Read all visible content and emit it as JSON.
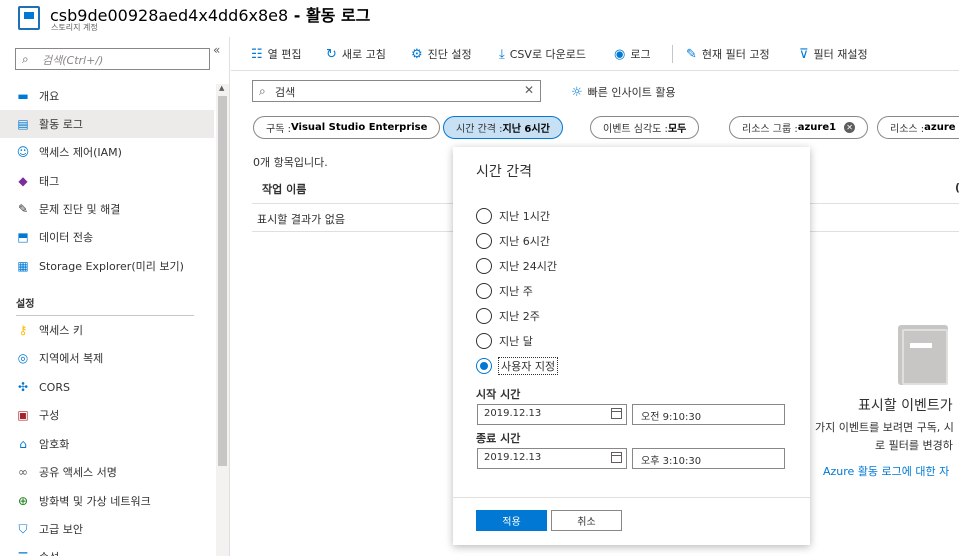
{
  "header": {
    "title": "csb9de00928aed4x4dd6x8e8",
    "separator": " - ",
    "page": "활동 로그",
    "subtitle": "스토리지 계정"
  },
  "sidebar": {
    "search_placeholder": "검색(Ctrl+/)",
    "collapse_icon": "«",
    "section_settings": "설정",
    "items": [
      {
        "label": "개요",
        "icon": "overview-icon",
        "color": "#0078d4"
      },
      {
        "label": "활동 로그",
        "icon": "activity-log-icon",
        "color": "#0078d4",
        "active": true
      },
      {
        "label": "액세스 제어(IAM)",
        "icon": "iam-icon",
        "color": "#0078d4"
      },
      {
        "label": "태그",
        "icon": "tag-icon",
        "color": "#7a2e9c"
      },
      {
        "label": "문제 진단 및 해결",
        "icon": "wrench-icon",
        "color": "#323130"
      },
      {
        "label": "데이터 전송",
        "icon": "data-transfer-icon",
        "color": "#0078d4"
      },
      {
        "label": "Storage Explorer(미리 보기)",
        "icon": "storage-explorer-icon",
        "color": "#0078d4"
      },
      {
        "label": "액세스 키",
        "icon": "key-icon",
        "color": "#ffb900"
      },
      {
        "label": "지역에서 복제",
        "icon": "geo-replication-icon",
        "color": "#0078d4"
      },
      {
        "label": "CORS",
        "icon": "cors-icon",
        "color": "#0078d4"
      },
      {
        "label": "구성",
        "icon": "configuration-icon",
        "color": "#a4262c"
      },
      {
        "label": "암호화",
        "icon": "lock-icon",
        "color": "#0078d4"
      },
      {
        "label": "공유 액세스 서명",
        "icon": "link-icon",
        "color": "#605e5c"
      },
      {
        "label": "방화벽 및 가상 네트워크",
        "icon": "network-icon",
        "color": "#107c10"
      },
      {
        "label": "고급 보안",
        "icon": "shield-icon",
        "color": "#0078d4"
      },
      {
        "label": "속성",
        "icon": "properties-icon",
        "color": "#0078d4"
      }
    ]
  },
  "toolbar": {
    "edit_columns": "열 편집",
    "refresh": "새로 고침",
    "diagnostic_settings": "진단 설정",
    "download_csv": "CSV로 다운로드",
    "logs": "로그",
    "pin_filters": "현재 필터 고정",
    "reset_filters": "필터 재설정"
  },
  "filters": {
    "search_placeholder": "검색",
    "quick_insights": "빠른 인사이트 활용",
    "pills": [
      {
        "key": "구독 : ",
        "value": "Visual Studio Enterprise"
      },
      {
        "key": "시간 간격 : ",
        "value": "지난 6시간"
      },
      {
        "key": "이벤트 심각도 : ",
        "value": "모두"
      },
      {
        "key": "리소스 그룹 : ",
        "value": "azure1"
      },
      {
        "key": "리소스 : ",
        "value": "azure"
      }
    ]
  },
  "results": {
    "count_text": "0개 항목입니다.",
    "col_operation": "작업 이름",
    "col_second": "(",
    "no_results": "표시할 결과가 없음",
    "empty_title": "표시할 이벤트가",
    "empty_desc1": "가지 이벤트를 보려면 구독, 시",
    "empty_desc2": "로 필터를 변경하",
    "empty_link": "Azure 활동 로그에 대한 자"
  },
  "time_panel": {
    "title": "시간 간격",
    "options": [
      "지난 1시간",
      "지난 6시간",
      "지난 24시간",
      "지난 주",
      "지난 2주",
      "지난 달",
      "사용자 지정"
    ],
    "selected": "사용자 지정",
    "start_label": "시작 시간",
    "start_date": "2019.12.13",
    "start_time": "오전 9:10:30",
    "end_label": "종료 시간",
    "end_date": "2019.12.13",
    "end_time": "오후 3:10:30",
    "apply": "적용",
    "cancel": "취소"
  }
}
